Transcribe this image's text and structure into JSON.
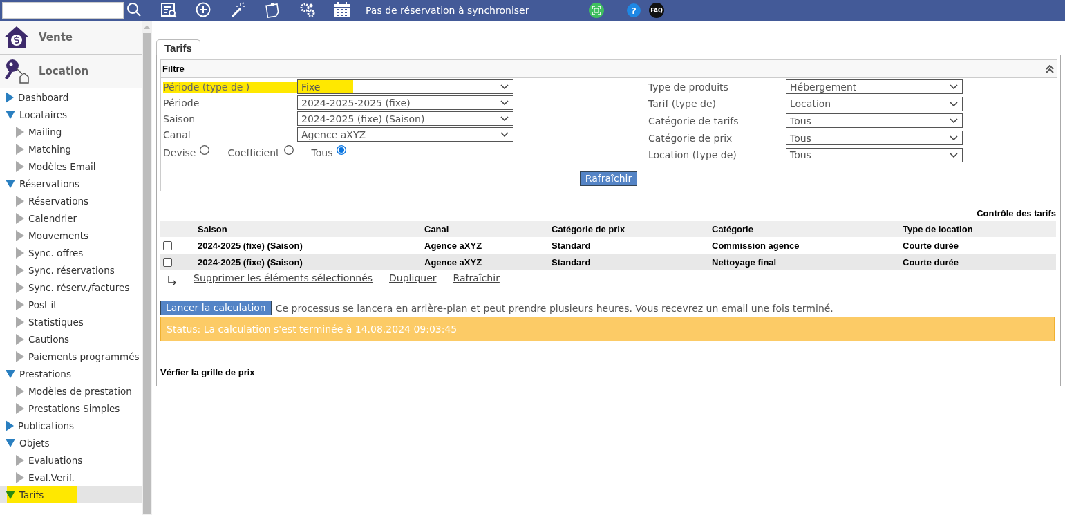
{
  "topbar": {
    "status": "Pas de réservation à synchroniser",
    "help": "?",
    "faq": "FAQ"
  },
  "sidebar": {
    "modules": [
      {
        "label": "Vente",
        "kind": "sale"
      },
      {
        "label": "Location",
        "kind": "rental"
      }
    ],
    "items": [
      {
        "label": "Dashboard",
        "expanded": false,
        "selected": false,
        "highlighted": false
      },
      {
        "label": "Locataires",
        "expanded": true,
        "selected": false,
        "highlighted": false,
        "children": [
          {
            "label": "Mailing",
            "selected": false
          },
          {
            "label": "Matching",
            "selected": false
          },
          {
            "label": "Modèles Email",
            "selected": false
          }
        ]
      },
      {
        "label": "Réservations",
        "expanded": true,
        "selected": false,
        "highlighted": false,
        "children": [
          {
            "label": "Réservations",
            "selected": false
          },
          {
            "label": "Calendrier",
            "selected": false
          },
          {
            "label": "Mouvements",
            "selected": false
          },
          {
            "label": "Sync. offres",
            "selected": false
          },
          {
            "label": "Sync. réservations",
            "selected": false
          },
          {
            "label": "Sync. réserv./factures",
            "selected": false
          },
          {
            "label": "Post it",
            "selected": false
          },
          {
            "label": "Statistiques",
            "selected": false
          },
          {
            "label": "Cautions",
            "selected": false
          },
          {
            "label": "Paiements programmés",
            "selected": false
          }
        ]
      },
      {
        "label": "Prestations",
        "expanded": true,
        "selected": false,
        "highlighted": false,
        "children": [
          {
            "label": "Modèles de prestation",
            "selected": false
          },
          {
            "label": "Prestations Simples",
            "selected": false
          }
        ]
      },
      {
        "label": "Publications",
        "expanded": false,
        "selected": false,
        "highlighted": false
      },
      {
        "label": "Objets",
        "expanded": true,
        "selected": false,
        "highlighted": false,
        "children": [
          {
            "label": "Evaluations",
            "selected": false
          },
          {
            "label": "Eval.Verif.",
            "selected": false
          }
        ]
      },
      {
        "label": "Tarifs",
        "expanded": true,
        "selected": true,
        "highlighted": true
      }
    ]
  },
  "tabs": [
    {
      "label": "Tarifs",
      "selected": true
    }
  ],
  "filter": {
    "title": "Filtre",
    "left": [
      {
        "label": "Période (type de )",
        "value": "Fixe",
        "highlighted": true
      },
      {
        "label": "Période",
        "value": "2024-2025-2025 (fixe)",
        "highlighted": false
      },
      {
        "label": "Saison",
        "value": "2024-2025 (fixe) (Saison)",
        "highlighted": false
      },
      {
        "label": "Canal",
        "value": "Agence aXYZ",
        "highlighted": false
      }
    ],
    "radios": [
      {
        "label": "Devise",
        "selected": false
      },
      {
        "label": "Coefficient",
        "selected": false
      },
      {
        "label": "Tous",
        "selected": true
      }
    ],
    "right": [
      {
        "label": "Type de produits",
        "value": "Hébergement",
        "highlighted": false
      },
      {
        "label": "Tarif (type de)",
        "value": "Location",
        "highlighted": false
      },
      {
        "label": "Catégorie de tarifs",
        "value": "Tous",
        "highlighted": false
      },
      {
        "label": "Catégorie de prix",
        "value": "Tous",
        "highlighted": false
      },
      {
        "label": "Location (type de)",
        "value": "Tous",
        "highlighted": false
      }
    ],
    "refresh": "Rafraîchir"
  },
  "table": {
    "caption": "Contrôle des tarifs",
    "columns": [
      "Saison",
      "Canal",
      "Catégorie de prix",
      "Catégorie",
      "Type de location"
    ],
    "rows": [
      {
        "checked": false,
        "cells": [
          "2024-2025 (fixe) (Saison)",
          "Agence aXYZ",
          "Standard",
          "Commission agence",
          "Courte durée"
        ]
      },
      {
        "checked": false,
        "cells": [
          "2024-2025 (fixe) (Saison)",
          "Agence aXYZ",
          "Standard",
          "Nettoyage final",
          "Courte durée"
        ]
      }
    ]
  },
  "actions": [
    "Supprimer les éléments sélectionnés",
    "Dupliquer",
    "Rafraîchir"
  ],
  "calculation": {
    "button": "Lancer la calculation",
    "note": "Ce processus se lancera en arrière-plan et peut prendre plusieurs heures. Vous recevrez un email une fois terminé.",
    "status": "Status: La calculation s'est terminée à 14.08.2024 09:03:45"
  },
  "price_grid": {
    "title": "Vérfier la grille de prix"
  }
}
